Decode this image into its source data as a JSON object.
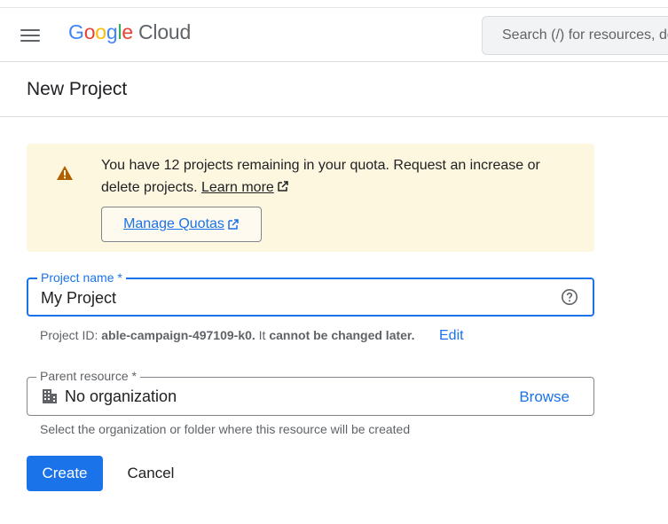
{
  "header": {
    "logo": {
      "g": "G",
      "o1": "o",
      "o2": "o",
      "g2": "g",
      "l": "l",
      "e": "e",
      "cloud": "Cloud"
    },
    "search_placeholder": "Search (/) for resources, docs, products, and more"
  },
  "page": {
    "title": "New Project"
  },
  "banner": {
    "message": "You have 12 projects remaining in your quota. Request an increase or delete projects.",
    "learn_more": "Learn more",
    "manage_quotas": "Manage Quotas"
  },
  "project_name": {
    "label": "Project name *",
    "value": "My Project"
  },
  "project_id": {
    "prefix": "Project ID:",
    "id": "able-campaign-497109-k0.",
    "mid": "It",
    "bold2": "cannot be changed later.",
    "edit": "Edit"
  },
  "parent_resource": {
    "label": "Parent resource *",
    "value": "No organization",
    "browse": "Browse",
    "hint": "Select the organization or folder where this resource will be created"
  },
  "actions": {
    "create": "Create",
    "cancel": "Cancel"
  },
  "colors": {
    "primary": "#1a73e8",
    "warning_bg": "#fef7e0",
    "warning_icon": "#b06000"
  },
  "icons": [
    "menu-icon",
    "warning-icon",
    "external-link-icon",
    "help-icon",
    "building-icon"
  ]
}
